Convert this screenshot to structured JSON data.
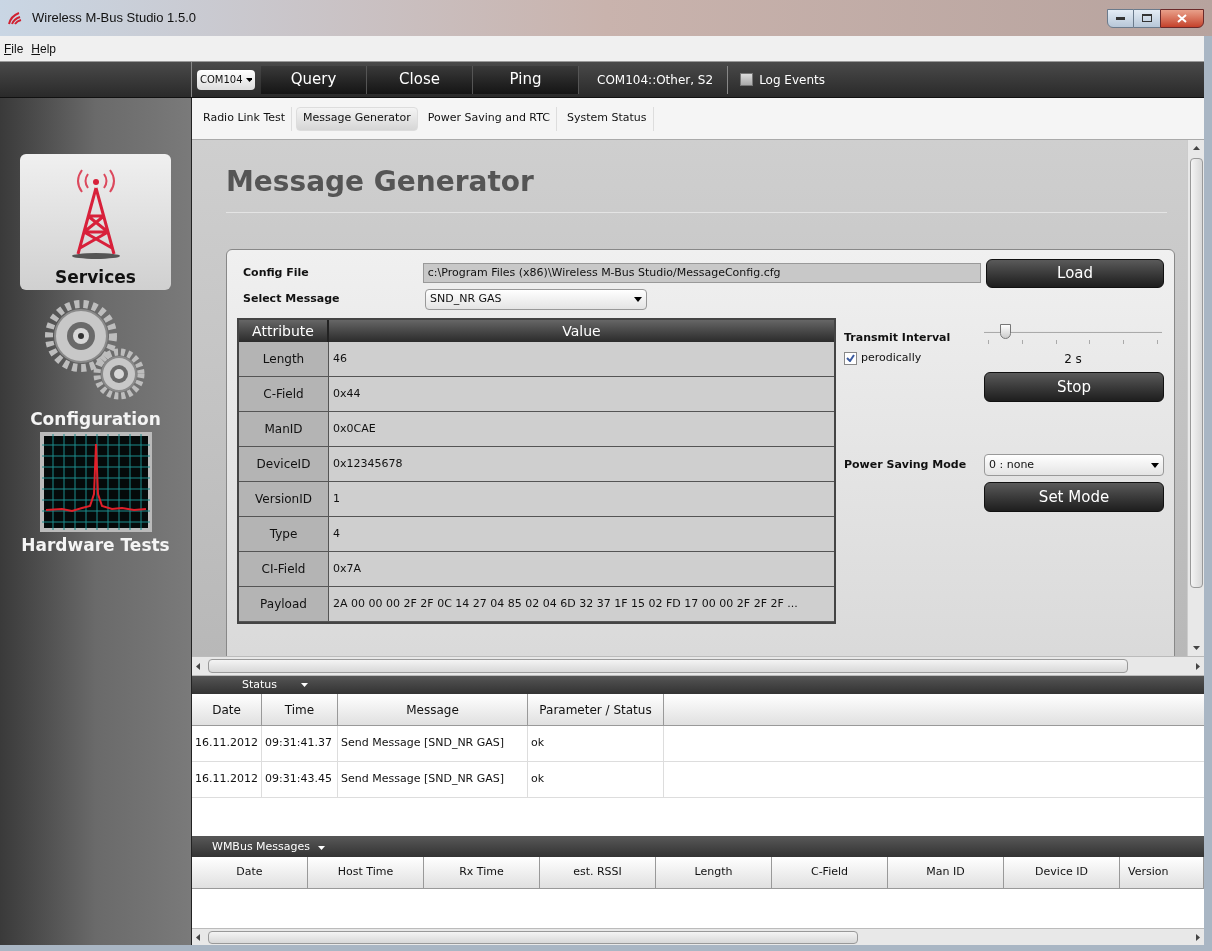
{
  "window": {
    "title": "Wireless M-Bus Studio  1.5.0"
  },
  "menu": [
    {
      "label": "File"
    },
    {
      "label": "Help"
    }
  ],
  "toolbar": {
    "port": "COM104",
    "buttons": [
      "Query",
      "Close",
      "Ping"
    ],
    "connection": "COM104::Other, S2",
    "log_events": {
      "label": "Log Events",
      "checked": false
    }
  },
  "sidebar": {
    "items": [
      {
        "label": "Services",
        "kind": "tower",
        "selected": true
      },
      {
        "label": "Configuration",
        "kind": "gears",
        "selected": false
      },
      {
        "label": "Hardware Tests",
        "kind": "spectrum",
        "selected": false
      }
    ]
  },
  "tabs": [
    {
      "label": "Radio Link Test",
      "selected": false
    },
    {
      "label": "Message Generator",
      "selected": true
    },
    {
      "label": "Power Saving and RTC",
      "selected": false
    },
    {
      "label": "System Status",
      "selected": false
    }
  ],
  "page": {
    "title": "Message Generator",
    "config_file": {
      "label": "Config File",
      "value": "c:\\Program Files (x86)\\Wireless M-Bus Studio/MessageConfig.cfg"
    },
    "load_button": "Load",
    "select_message": {
      "label": "Select Message",
      "value": "SND_NR GAS"
    },
    "table": {
      "columns": [
        "Attribute",
        "Value"
      ],
      "rows": [
        {
          "attribute": "Length",
          "value": "46"
        },
        {
          "attribute": "C-Field",
          "value": "0x44"
        },
        {
          "attribute": "ManID",
          "value": "0x0CAE"
        },
        {
          "attribute": "DeviceID",
          "value": "0x12345678"
        },
        {
          "attribute": "VersionID",
          "value": "1"
        },
        {
          "attribute": "Type",
          "value": "4"
        },
        {
          "attribute": "CI-Field",
          "value": "0x7A"
        },
        {
          "attribute": "Payload",
          "value": "2A 00 00 00 2F 2F 0C 14 27 04 85 02 04 6D 32 37 1F 15 02 FD 17 00 00 2F 2F 2F ..."
        }
      ]
    },
    "transmit_interval": {
      "label": "Transmit Interval",
      "level": 0.12,
      "reading": "2 s"
    },
    "periodically": {
      "label": "perodically",
      "checked": true
    },
    "stop_button": "Stop",
    "power_saving": {
      "label": "Power Saving Mode",
      "value": "0 : none"
    },
    "set_mode_button": "Set Mode"
  },
  "status": {
    "title": "Status",
    "columns": [
      "Date",
      "Time",
      "Message",
      "Parameter / Status"
    ],
    "rows": [
      [
        "16.11.2012",
        "09:31:41.37",
        "Send Message [SND_NR GAS]",
        "ok"
      ],
      [
        "16.11.2012",
        "09:31:43.45",
        "Send Message [SND_NR GAS]",
        "ok"
      ]
    ]
  },
  "wmbus": {
    "title": "WMBus Messages",
    "columns": [
      "Date",
      "Host Time",
      "Rx Time",
      "est. RSSI",
      "Length",
      "C-Field",
      "Man ID",
      "Device ID",
      "Version"
    ]
  }
}
